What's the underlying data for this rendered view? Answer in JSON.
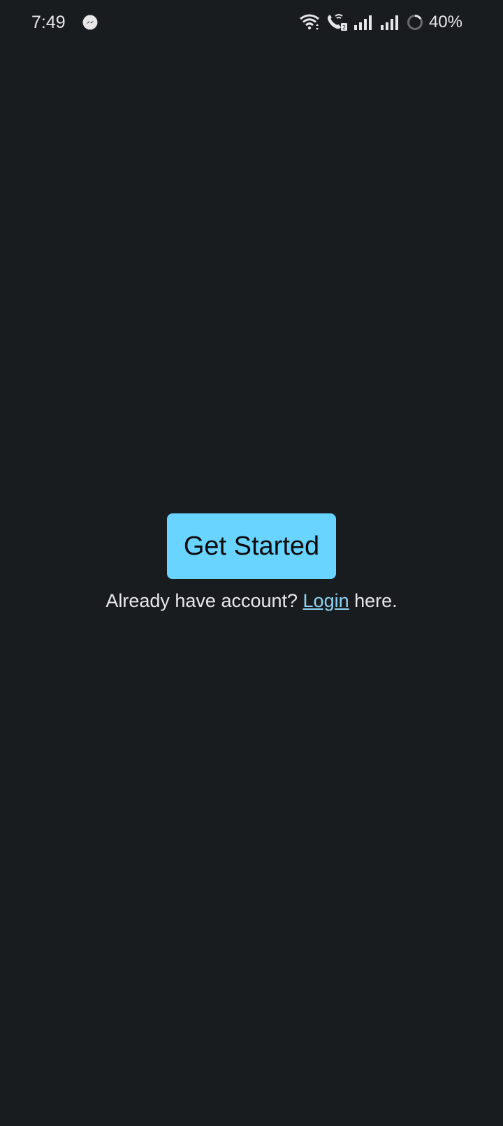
{
  "status_bar": {
    "time": "7:49",
    "notification_icon": "messenger-icon",
    "icons": [
      "wifi-icon",
      "wifi-calling-icon",
      "signal-icon",
      "signal-icon",
      "battery-saver-icon"
    ],
    "battery": "40%"
  },
  "main": {
    "get_started_label": "Get Started",
    "login_prompt_prefix": "Already have account? ",
    "login_link_label": "Login",
    "login_prompt_suffix": " here."
  },
  "colors": {
    "background": "#191c1f",
    "button": "#69d4ff",
    "link": "#8fd3f4",
    "text": "#e8e8e8"
  }
}
